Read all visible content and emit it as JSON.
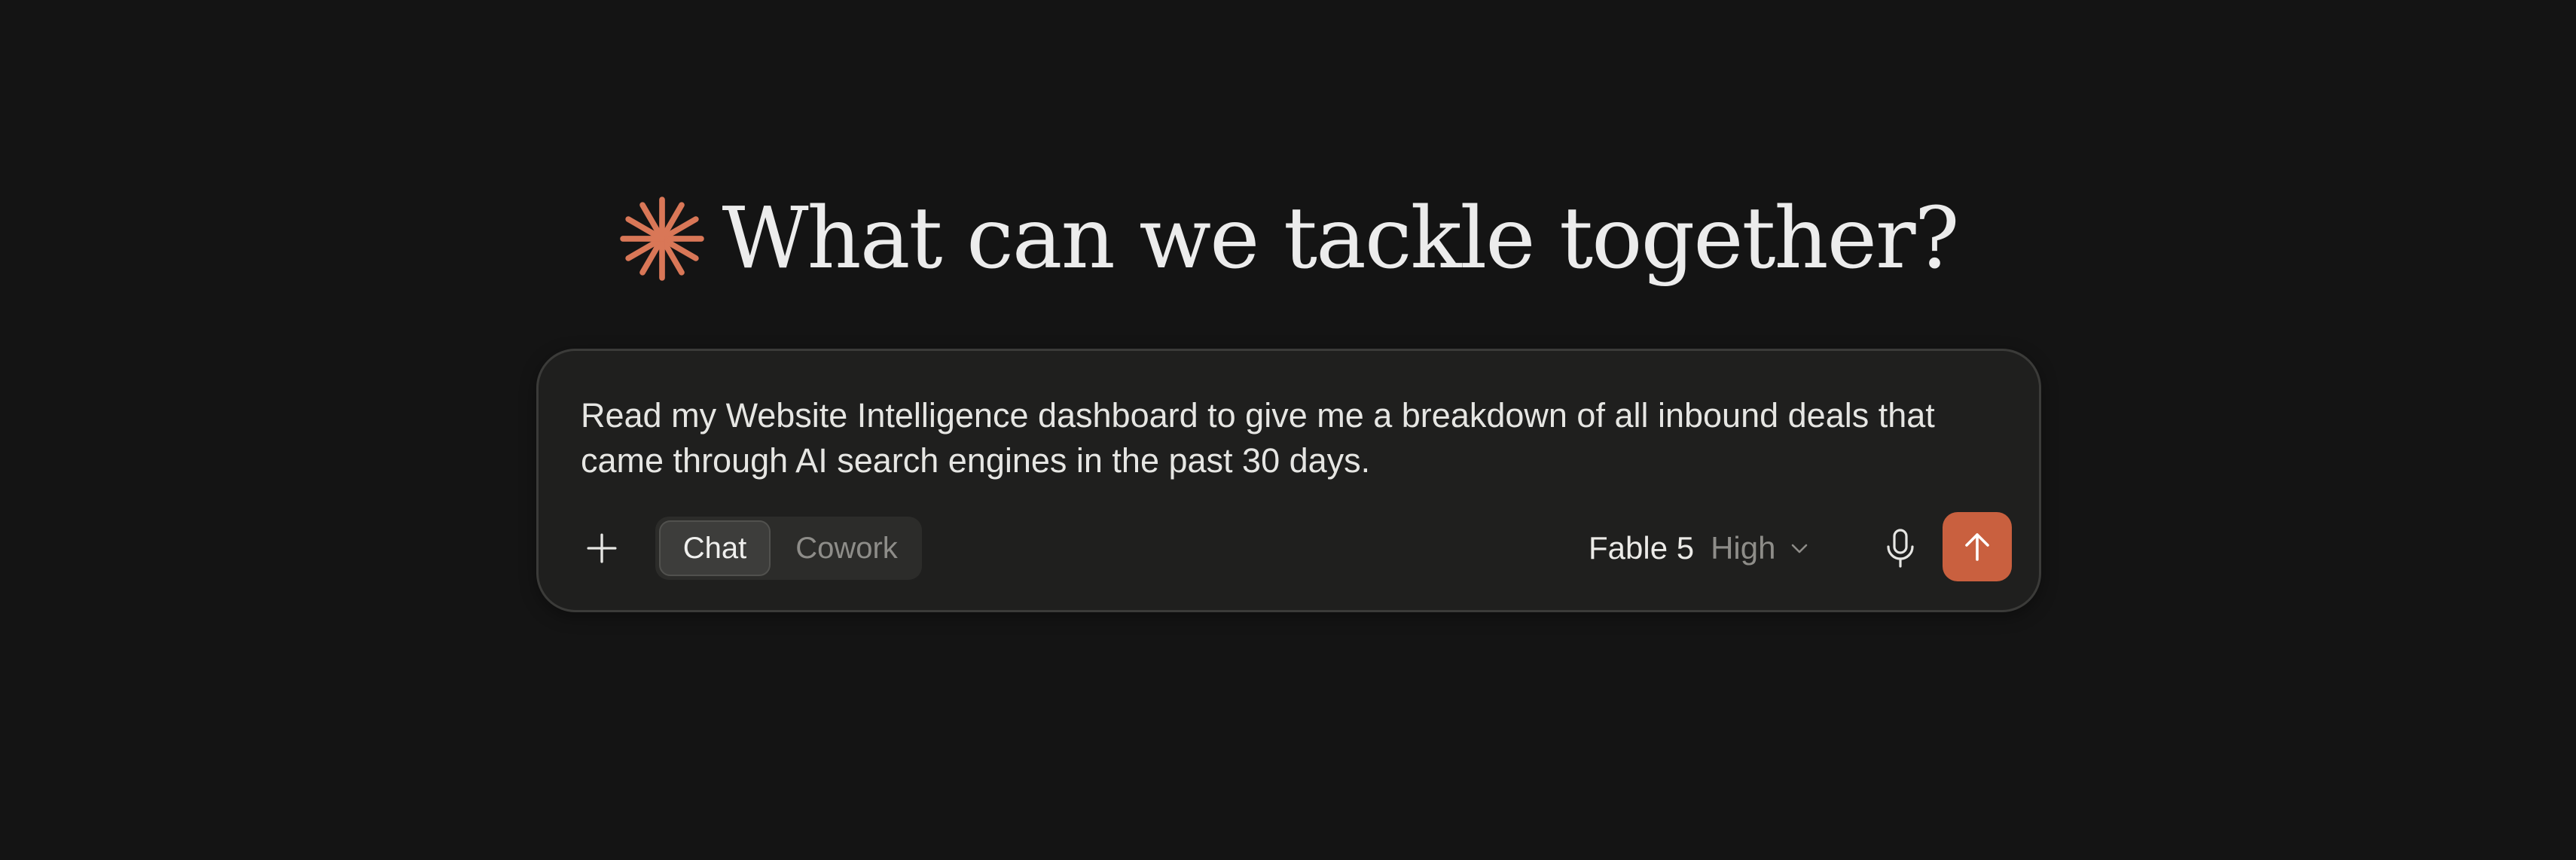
{
  "greeting": {
    "title": "What can we tackle together?",
    "logo_icon": "spark-icon"
  },
  "composer": {
    "input_value": "Read my Website Intelligence dashboard to give me a breakdown of all inbound deals that came through AI search engines in the past 30 days.",
    "add_icon": "plus-icon",
    "modes": [
      {
        "label": "Chat",
        "selected": true
      },
      {
        "label": "Cowork",
        "selected": false
      }
    ],
    "model": {
      "name": "Fable 5",
      "effort": "High",
      "icon": "chevron-down-icon"
    },
    "mic_icon": "microphone-icon",
    "send_icon": "arrow-up-icon"
  },
  "colors": {
    "background": "#141414",
    "composer_background": "#1f1f1e",
    "composer_border": "#3b3b39",
    "accent": "#c9603f",
    "spark": "#d97757",
    "text_primary": "#ececec",
    "text_muted": "#8e8d89"
  }
}
